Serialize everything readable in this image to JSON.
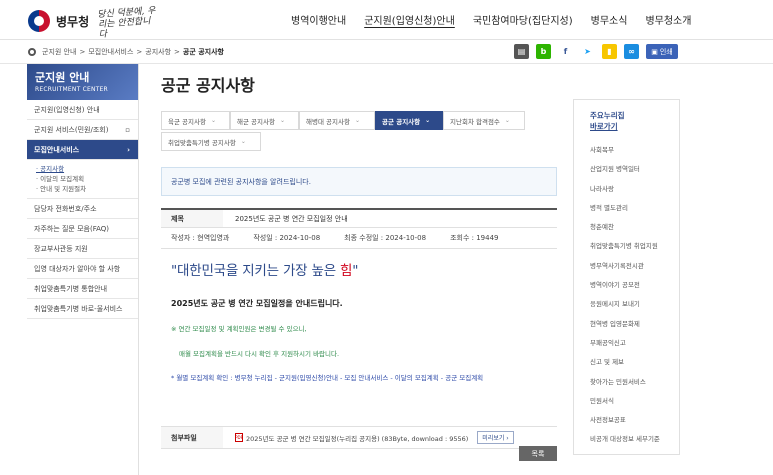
{
  "header": {
    "logo_text": "병무청",
    "slogan": "당신 덕분에, 우리는 안전합니다",
    "nav": [
      "병역이행안내",
      "군지원(입영신청)안내",
      "국민참여마당(집단지성)",
      "병무소식",
      "병무청소개"
    ]
  },
  "breadcrumb": [
    "군지원 안내",
    "모집안내서비스",
    "공지사항",
    "공군 공지사항"
  ],
  "tools": {
    "print_label": "인쇄",
    "icons": [
      "printer-small-icon",
      "blog-icon",
      "facebook-icon",
      "twitter-icon",
      "kakaostory-icon",
      "link-icon"
    ]
  },
  "lnb": {
    "title": "군지원 안내",
    "subtitle": "RECRUITMENT CENTER",
    "items": [
      {
        "label": "군지원(입영신청) 안내"
      },
      {
        "label": "군지원 서비스(민원/조회)",
        "mark": "▫"
      },
      {
        "label": "모집안내서비스",
        "mark": "›",
        "active": true
      },
      {
        "label": "담당자 전화번호/주소"
      },
      {
        "label": "자주하는 질문 모음(FAQ)"
      },
      {
        "label": "장교부사관등 지원"
      },
      {
        "label": "입영 대상자가 알아야 할 사항"
      },
      {
        "label": "취업맞춤특기병 통합안내"
      },
      {
        "label": "취업맞춤특기병 바로-울서비스"
      }
    ],
    "sub": [
      "· 공지사항",
      "· 이달의 모집계획",
      "· 안내 및 지원절차"
    ]
  },
  "main": {
    "title": "공군 공지사항",
    "tabs": [
      "육군 공지사항",
      "해군 공지사항",
      "해병대 공지사항",
      "공군 공지사항",
      "지난회차 합격점수",
      "취업맞춤특기병 공지사항"
    ],
    "info": "공군병 모집에 관련된 공지사항을 알려드립니다.",
    "view": {
      "title_label": "제목",
      "title": "2025년도 공군 병 연간 모집일정 안내",
      "author": "작성자 : 현역입영과",
      "date": "작성일 : 2024-10-08",
      "modified": "최종 수정일 : 2024-10-08",
      "views": "조회수 : 19449",
      "hero_main": "\"대한민국을 지키는 가장 높은 ",
      "hero_red": "힘",
      "hero_end": "\"",
      "line1": "2025년도 공군 병 연간 모집일정을 안내드립니다.",
      "line2": "※ 연간 모집일정 및 계획인원은 변경될 수 있으니,",
      "line3": "매월 모집계획을 반드시 다시 확인 후 지원하시기 바랍니다.",
      "line4": "* 월별 모집계획 확인 : 병무청 누리집 - 군지원(입영신청)안내 - 모집 안내서비스 - 이달의 모집계획 - 공군 모집계획",
      "file_label": "첨부파일",
      "file_name": "2025년도 공군 병 연간 모집일정(누리집 공지용) (83Byte, download : 9556)",
      "preview_label": "미리보기 ›"
    },
    "list_button": "목록"
  },
  "quick": {
    "title1": "주요누리집",
    "title2": "바로가기",
    "items": [
      "사회복무",
      "산업지원 병역일터",
      "나라사랑",
      "병적 별도관리",
      "청춘예찬",
      "취업맞춤특기병 취업지원",
      "병무역사기록전시관",
      "병역이야기 공모전",
      "응원메시지 보내기",
      "현역병 입영문화제",
      "부패공익신고",
      "신고 및 제보",
      "찾아가는 민원서비스",
      "민원서식",
      "사전정보공표",
      "비공개 대상정보 세부기준"
    ]
  },
  "colors": {
    "brand": "#2d4a8a",
    "accent_red": "#d0021b"
  }
}
